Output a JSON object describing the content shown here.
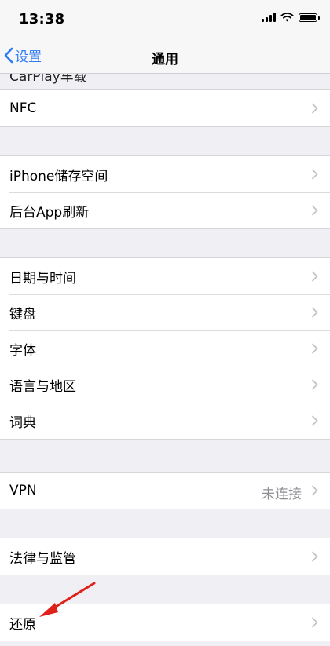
{
  "status_bar": {
    "time": "13:38"
  },
  "nav": {
    "back_label": "设置",
    "title": "通用"
  },
  "partial_row": {
    "label": "CarPlay车载"
  },
  "groups": [
    {
      "rows": [
        {
          "label": "NFC"
        }
      ]
    },
    {
      "rows": [
        {
          "label": "iPhone储存空间"
        },
        {
          "label": "后台App刷新"
        }
      ]
    },
    {
      "rows": [
        {
          "label": "日期与时间"
        },
        {
          "label": "键盘"
        },
        {
          "label": "字体"
        },
        {
          "label": "语言与地区"
        },
        {
          "label": "词典"
        }
      ]
    },
    {
      "rows": [
        {
          "label": "VPN",
          "value": "未连接"
        }
      ]
    },
    {
      "rows": [
        {
          "label": "法律与监管"
        }
      ]
    },
    {
      "rows": [
        {
          "label": "还原"
        }
      ]
    }
  ],
  "colors": {
    "accent": "#2f7bf6",
    "annotation_arrow": "#e0201b",
    "background": "#efeff4"
  }
}
